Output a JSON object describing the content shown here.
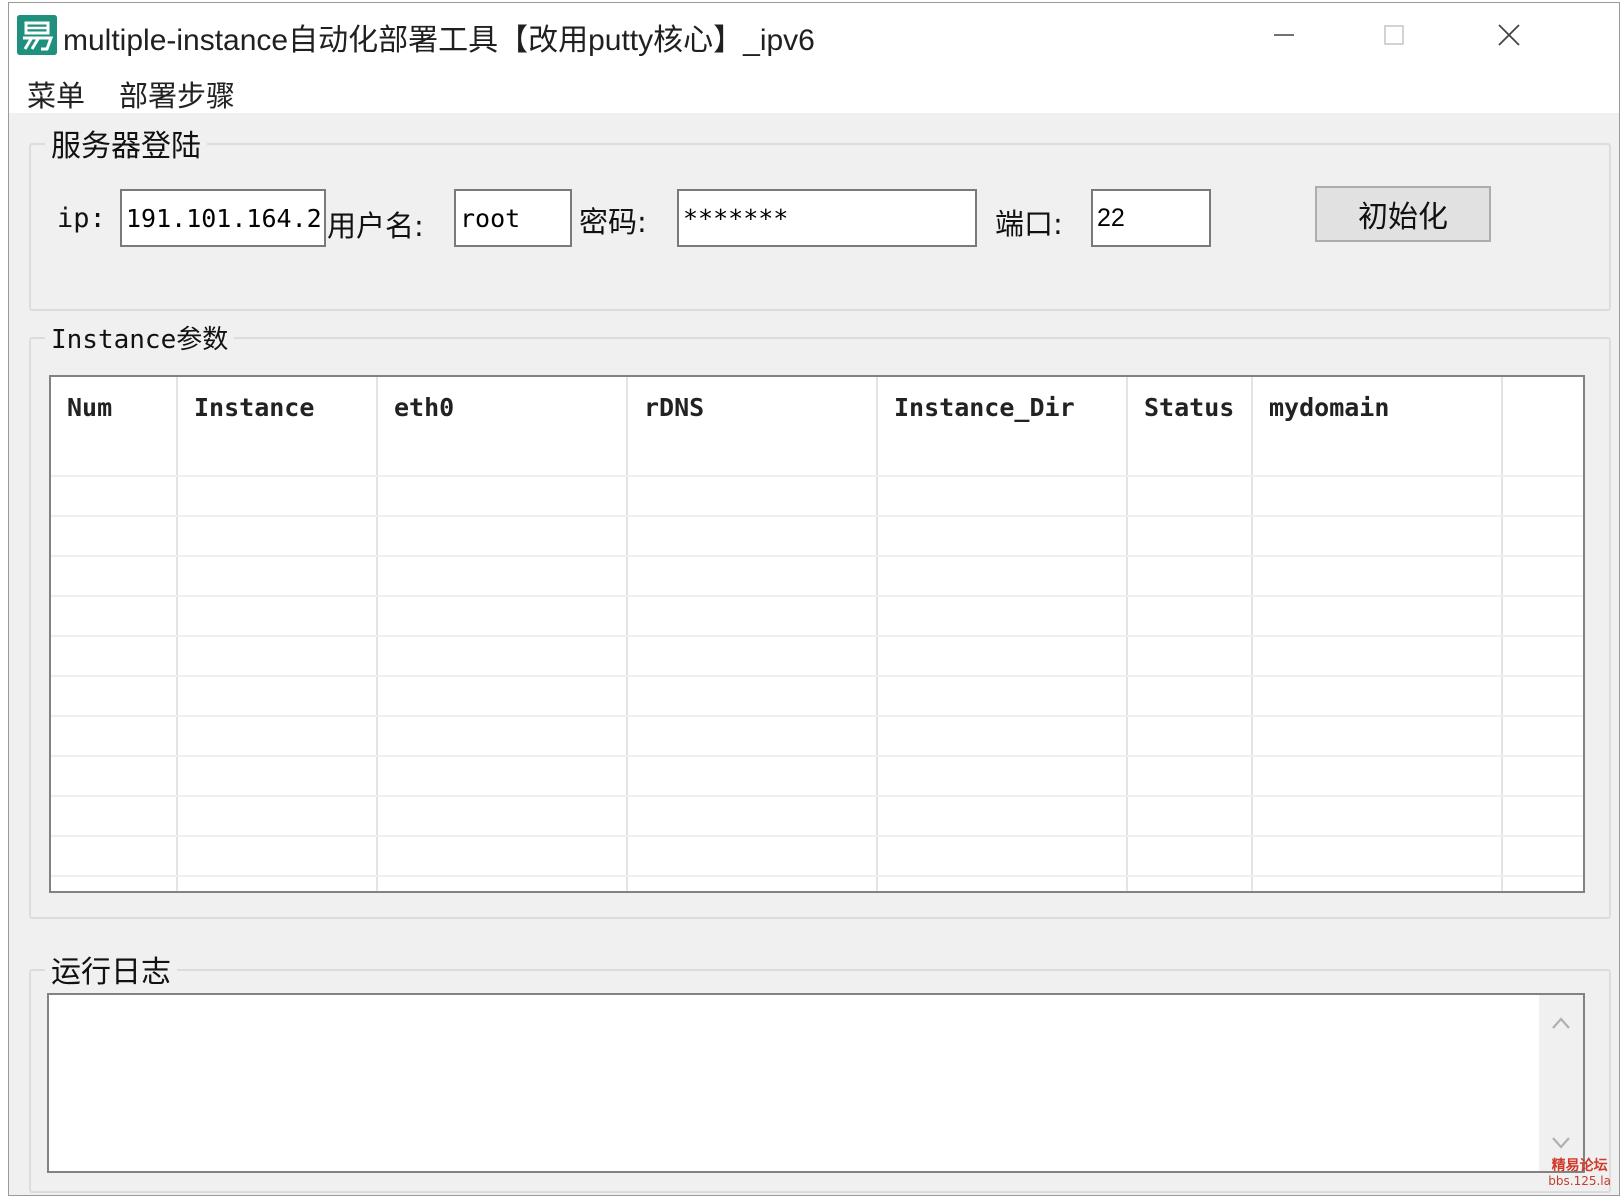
{
  "window": {
    "title": "multiple-instance自动化部署工具【改用putty核心】_ipv6",
    "app_icon": "yi-language-icon",
    "accent_color": "#1f8f7e"
  },
  "menubar": {
    "items": [
      "菜单",
      "部署步骤"
    ]
  },
  "login_group": {
    "title": "服务器登陆",
    "ip_label": "ip:",
    "ip_value": "191.101.164.2",
    "username_label": "用户名:",
    "username_value": "root",
    "password_label": "密码:",
    "password_value": "*******",
    "port_label": "端口:",
    "port_value": "22",
    "init_button": "初始化"
  },
  "instance_group": {
    "title": "Instance参数",
    "columns": [
      "Num",
      "Instance",
      "eth0",
      "rDNS",
      "Instance_Dir",
      "Status",
      "mydomain"
    ],
    "rows": []
  },
  "log_group": {
    "title": "运行日志",
    "content": ""
  },
  "watermark": {
    "line1": "精易论坛",
    "line2": "bbs.125.la"
  }
}
